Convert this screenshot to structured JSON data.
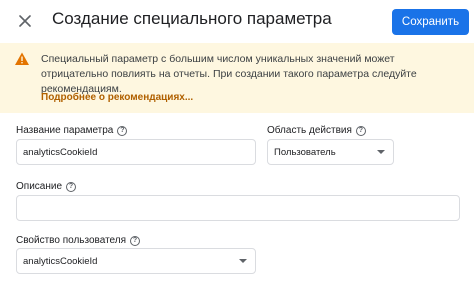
{
  "header": {
    "title": "Создание специального параметра",
    "save_label": "Сохранить"
  },
  "banner": {
    "text": "Специальный параметр с большим числом уникальных значений может отрицательно повлиять на отчеты. При создании такого параметра следуйте рекомендациям.",
    "link": "Подробнее о рекомендациях..."
  },
  "form": {
    "name_label": "Название параметра",
    "name_value": "analyticsCookieId",
    "scope_label": "Область действия",
    "scope_value": "Пользователь",
    "description_label": "Описание",
    "description_value": "",
    "property_label": "Свойство пользователя",
    "property_value": "analyticsCookieId"
  },
  "icons": {
    "close": "close-icon",
    "warning": "warning-icon",
    "help": "help-icon",
    "dropdown": "chevron-down-icon"
  },
  "colors": {
    "primary": "#1a73e8",
    "banner_bg": "#fef7e0",
    "warning": "#e37400",
    "link": "#b06000"
  }
}
